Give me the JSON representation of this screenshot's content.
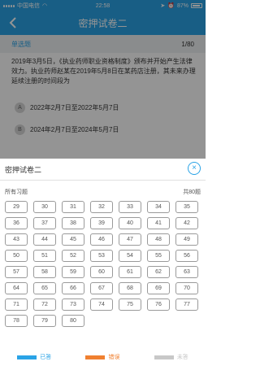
{
  "status_bar": {
    "carrier": "中国电信",
    "time": "22:58",
    "battery": "87%"
  },
  "nav": {
    "title": "密押试卷二"
  },
  "question_header": {
    "type": "单选题",
    "progress": "1/80"
  },
  "question": {
    "text": "2019年3月5日，《执业药师职业资格制度》颁布并开始产生法律效力。执业药师赵某在2019年5月8日在某药店注册，其未来办理延续注册的时间段为",
    "options": [
      {
        "letter": "A",
        "text": "2022年2月7日至2022年5月7日"
      },
      {
        "letter": "B",
        "text": "2024年2月7日至2024年5月7日"
      }
    ]
  },
  "answer_sheet": {
    "title": "密押试卷二",
    "close": "ⓧ",
    "all_label": "所有习题",
    "total_label": "共80题",
    "numbers": [
      "29",
      "30",
      "31",
      "32",
      "33",
      "34",
      "35",
      "36",
      "37",
      "38",
      "39",
      "40",
      "41",
      "42",
      "43",
      "44",
      "45",
      "46",
      "47",
      "48",
      "49",
      "50",
      "51",
      "52",
      "53",
      "54",
      "55",
      "56",
      "57",
      "58",
      "59",
      "60",
      "61",
      "62",
      "63",
      "64",
      "65",
      "66",
      "67",
      "68",
      "69",
      "70",
      "71",
      "72",
      "73",
      "74",
      "75",
      "76",
      "77",
      "78",
      "79",
      "80"
    ]
  },
  "legend": [
    {
      "label": "已答",
      "color": "#2aa3e6"
    },
    {
      "label": "错误",
      "color": "#f08030"
    },
    {
      "label": "未答",
      "color": "#c8c8c8"
    }
  ]
}
